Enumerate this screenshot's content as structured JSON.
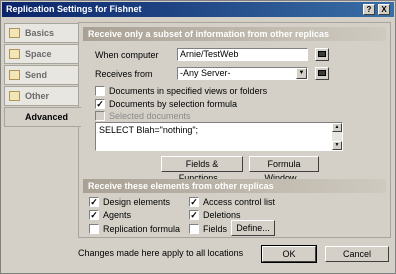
{
  "window": {
    "title": "Replication Settings for Fishnet"
  },
  "titlebar_buttons": {
    "help": "?",
    "close": "X"
  },
  "tabs": [
    {
      "label": "Basics"
    },
    {
      "label": "Space Savers"
    },
    {
      "label": "Send"
    },
    {
      "label": "Other"
    },
    {
      "label": "Advanced"
    }
  ],
  "section1": {
    "header": "Receive only a subset of information from other replicas",
    "when_computer_label": "When computer",
    "when_computer_value": "Arnie/TestWeb",
    "receives_from_label": "Receives from",
    "receives_from_value": "-Any Server-",
    "options": [
      {
        "label": "Documents in specified views or folders",
        "checked": false
      },
      {
        "label": "Documents by selection formula",
        "checked": true
      },
      {
        "label": "Selected documents",
        "checked": false
      }
    ],
    "formula": "SELECT Blah=\"nothing\";",
    "fields_button": "Fields & Functions...",
    "formula_window_button": "Formula Window..."
  },
  "section2": {
    "header": "Receive these elements from other replicas",
    "col1": [
      {
        "label": "Design elements",
        "checked": true
      },
      {
        "label": "Agents",
        "checked": true
      },
      {
        "label": "Replication formula",
        "checked": false
      }
    ],
    "col2": [
      {
        "label": "Access control list",
        "checked": true
      },
      {
        "label": "Deletions",
        "checked": true
      },
      {
        "label": "Fields",
        "checked": false
      }
    ],
    "define_button": "Define..."
  },
  "footer": {
    "note": "Changes made here apply to all locations",
    "ok": "OK",
    "cancel": "Cancel"
  },
  "check_glyph": "✓",
  "dropdown_glyph": "▼"
}
